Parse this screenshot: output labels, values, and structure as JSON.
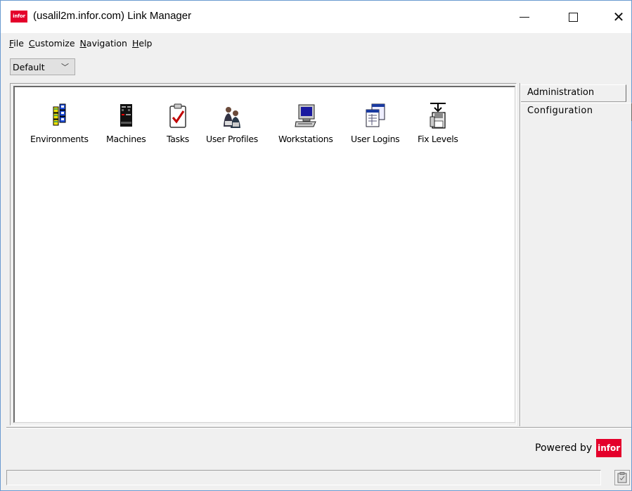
{
  "window": {
    "title": "(usalil2m.infor.com) Link Manager",
    "logo_text": "infor"
  },
  "menu": [
    {
      "label": "File",
      "mnemonic": "F",
      "rest": "ile"
    },
    {
      "label": "Customize",
      "mnemonic": "C",
      "rest": "ustomize"
    },
    {
      "label": "Navigation",
      "mnemonic": "N",
      "rest": "avigation"
    },
    {
      "label": "Help",
      "mnemonic": "H",
      "rest": "elp"
    }
  ],
  "view_select": {
    "value": "Default"
  },
  "icons": [
    {
      "label": "Environments",
      "icon": "environments-icon"
    },
    {
      "label": "Machines",
      "icon": "machines-icon"
    },
    {
      "label": "Tasks",
      "icon": "tasks-icon"
    },
    {
      "label": "User Profiles",
      "icon": "user-profiles-icon"
    },
    {
      "label": "Workstations",
      "icon": "workstations-icon"
    },
    {
      "label": "User Logins",
      "icon": "user-logins-icon"
    },
    {
      "label": "Fix Levels",
      "icon": "fix-levels-icon"
    }
  ],
  "tabs": [
    {
      "label": "Administration",
      "active": false
    },
    {
      "label": "Configuration",
      "active": true
    }
  ],
  "footer": {
    "powered_by": "Powered by",
    "logo_text": "infor",
    "status_text": ""
  },
  "colors": {
    "brand": "#e4002b"
  }
}
